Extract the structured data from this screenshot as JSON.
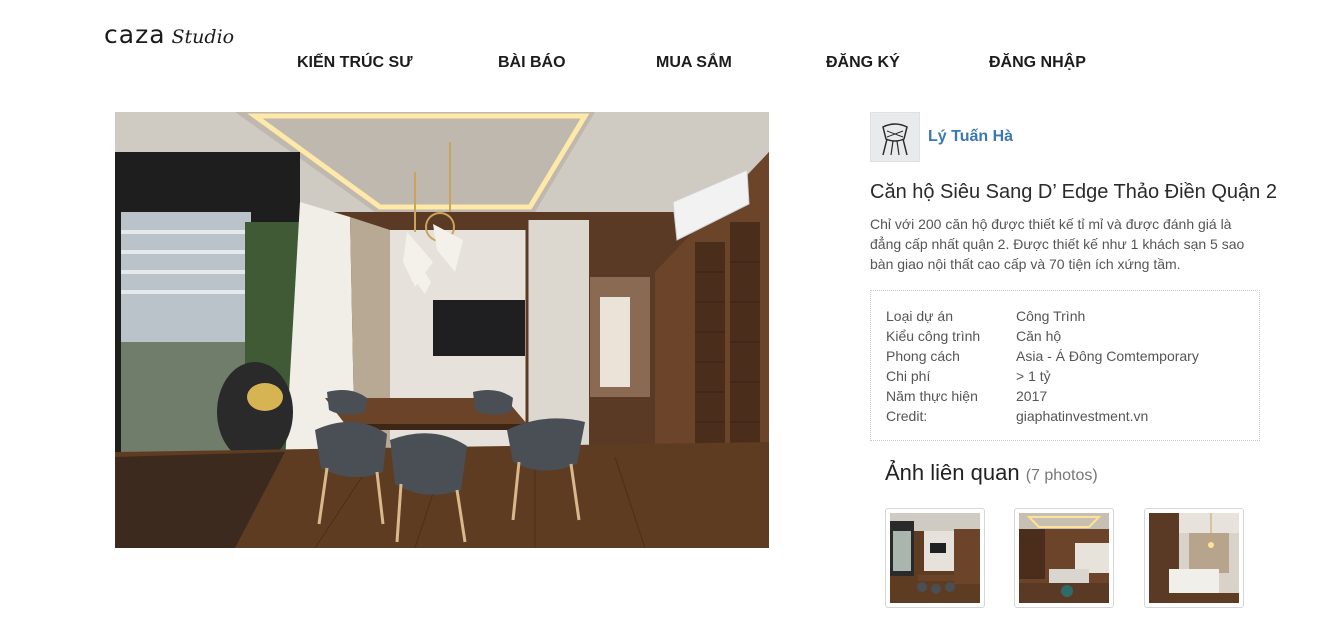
{
  "logo": {
    "word": "caza",
    "script": "Studio"
  },
  "nav": [
    {
      "label": "KIẾN TRÚC SƯ"
    },
    {
      "label": "BÀI BÁO"
    },
    {
      "label": "MUA SẮM"
    },
    {
      "label": "ĐĂNG KÝ"
    },
    {
      "label": "ĐĂNG NHẬP"
    }
  ],
  "author": {
    "name": "Lý Tuấn Hà",
    "avatar_icon": "chair-icon"
  },
  "project": {
    "title": "Căn hộ Siêu Sang D’ Edge Thảo Điền Quận 2",
    "description": "Chỉ với 200 căn hộ được thiết kế tỉ mỉ và được đánh giá là đẳng cấp nhất quận 2. Được thiết kế như 1 khách sạn 5 sao bàn giao nội thất cao cấp và 70 tiện ích xứng tầm."
  },
  "details": [
    {
      "label": "Loại dự án",
      "value": "Công Trình"
    },
    {
      "label": "Kiểu công trình",
      "value": "Căn hộ"
    },
    {
      "label": "Phong cách",
      "value": "Asia - Á Đông Comtemporary"
    },
    {
      "label": "Chi phí",
      "value": "> 1 tỷ"
    },
    {
      "label": "Năm thực hiện",
      "value": "2017"
    },
    {
      "label": "Credit:",
      "value": "giaphatinvestment.vn"
    }
  ],
  "related": {
    "title": "Ảnh liên quan",
    "count": "(7 photos)"
  },
  "colors": {
    "author_link": "#3a78b5",
    "wood": "#6b4429",
    "marble": "#e6e2db"
  }
}
